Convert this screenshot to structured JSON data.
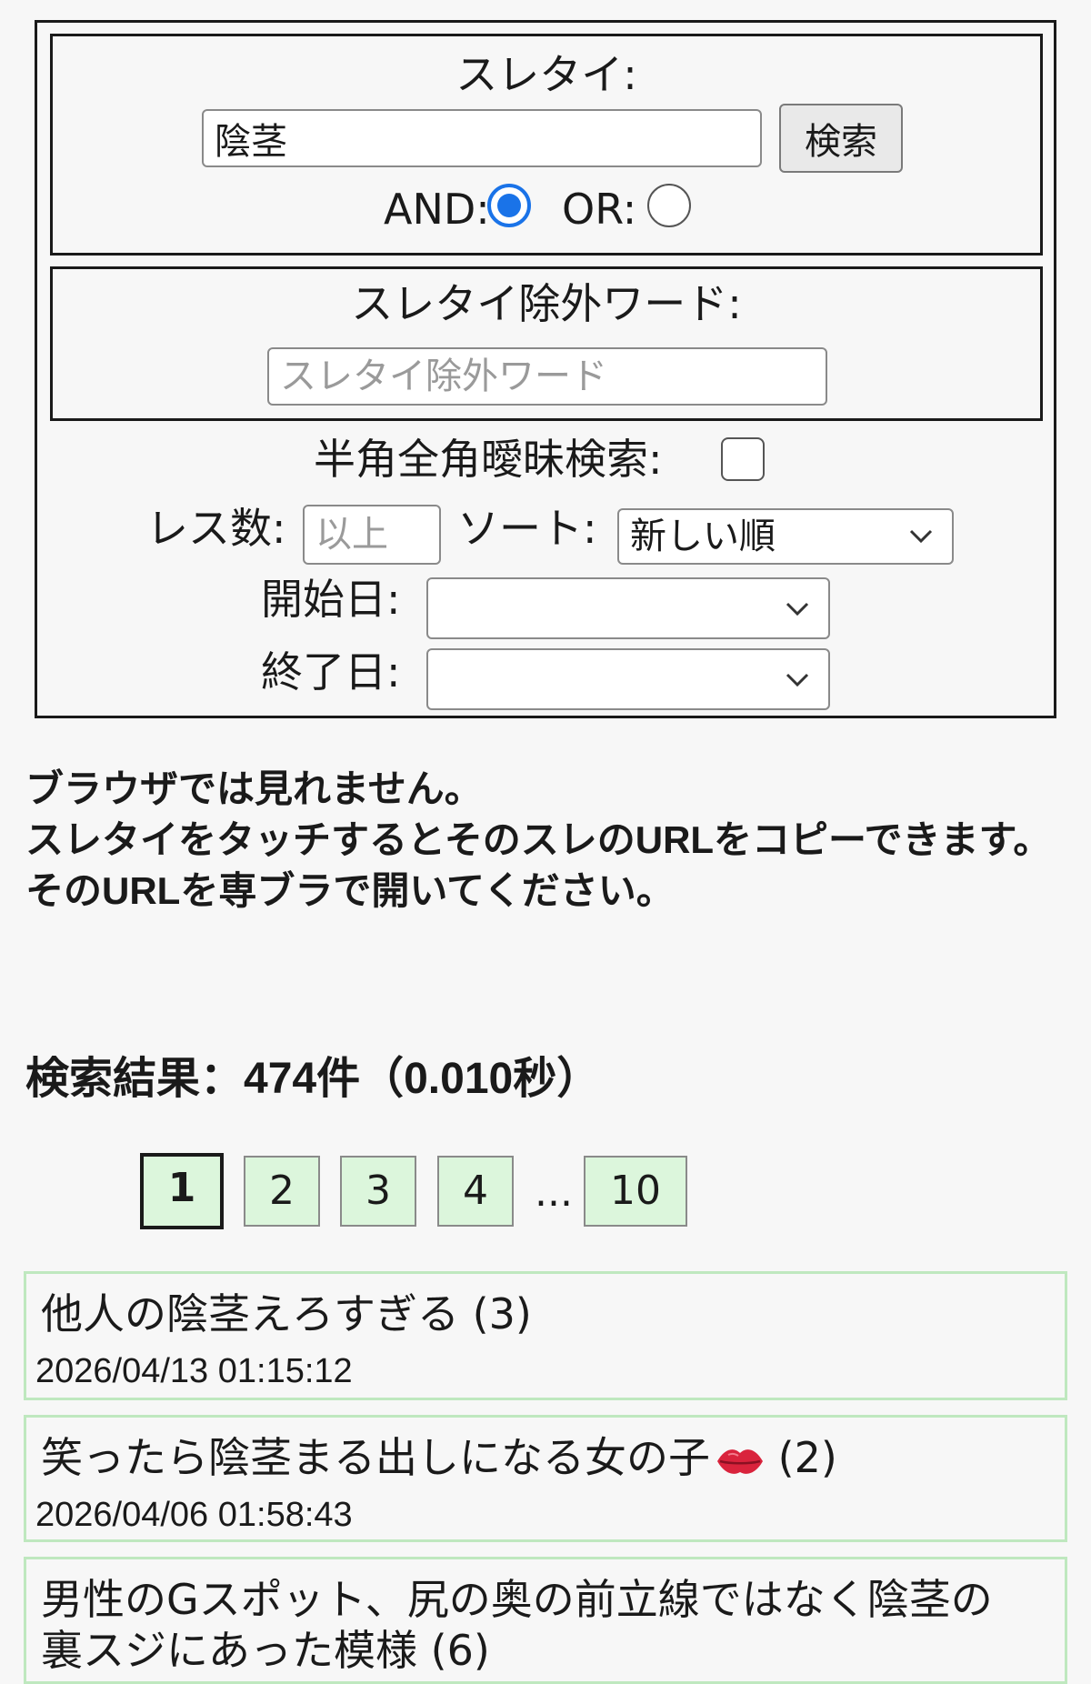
{
  "search": {
    "title_label": "スレタイ:",
    "title_value": "陰茎",
    "search_button": "検索",
    "and_label": "AND:",
    "or_label": "OR:",
    "mode": "AND",
    "exclude_label": "スレタイ除外ワード:",
    "exclude_placeholder": "スレタイ除外ワード",
    "fuzzy_label": "半角全角曖昧検索:",
    "fuzzy_checked": false,
    "res_label": "レス数:",
    "res_placeholder": "以上",
    "sort_label": "ソート:",
    "sort_value": "新しい順",
    "start_label": "開始日:",
    "start_value": "",
    "end_label": "終了日:",
    "end_value": ""
  },
  "notice": {
    "line1": "ブラウザでは見れません。",
    "line2": "スレタイをタッチするとそのスレのURLをコピーできます。",
    "line3": "そのURLを専ブラで開いてください。"
  },
  "results_summary": "検索結果：474件（0.010秒）",
  "pagination": {
    "pages": [
      "1",
      "2",
      "3",
      "4",
      "10"
    ],
    "current": "1",
    "ellipsis": "..."
  },
  "results": [
    {
      "title": "他人の陰茎えろすぎる (3)",
      "date": "2026/04/13 01:15:12"
    },
    {
      "title": "笑ったら陰茎まる出しになる女の子",
      "suffix": " (2)",
      "date": "2026/04/06 01:58:43",
      "icon": "lips-icon"
    },
    {
      "title": "男性のGスポット、尻の奥の前立線ではなく陰茎の",
      "title_line2": "裏スジにあった模様 (6)"
    }
  ],
  "colors": {
    "accent": "#1a73e8",
    "page_bg": "#dcf6dc",
    "result_border": "#bfe8bf"
  }
}
